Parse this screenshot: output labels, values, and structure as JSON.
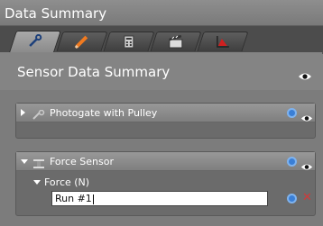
{
  "window": {
    "title": "Data Summary"
  },
  "tabs": [
    {
      "name": "wrench-tab",
      "icon": "wrench-icon",
      "active": true
    },
    {
      "name": "pencil-tab",
      "icon": "pencil-icon",
      "active": false
    },
    {
      "name": "calculator-tab",
      "icon": "calculator-icon",
      "active": false
    },
    {
      "name": "clapper-tab",
      "icon": "clapperboard-icon",
      "active": false
    },
    {
      "name": "graph-tab",
      "icon": "graph-icon",
      "active": false
    }
  ],
  "header": {
    "title": "Sensor Data Summary",
    "visibility_icon": "eye-icon"
  },
  "sensors": [
    {
      "label": "Photogate with Pulley",
      "icon": "photogate-icon",
      "expanded": false,
      "actions": [
        "gear-icon",
        "eye-icon"
      ]
    },
    {
      "label": "Force Sensor",
      "icon": "force-sensor-icon",
      "expanded": true,
      "actions": [
        "gear-icon",
        "eye-icon"
      ],
      "measurements": [
        {
          "label": "Force (N)",
          "expanded": true,
          "runs": [
            {
              "value": "Run #1"
            }
          ]
        }
      ]
    }
  ],
  "colors": {
    "accent_blue": "#3a7fd6",
    "delete_red": "#d13a3a",
    "tab_pencil": "#f07a20",
    "tab_graph": "#d02020"
  }
}
